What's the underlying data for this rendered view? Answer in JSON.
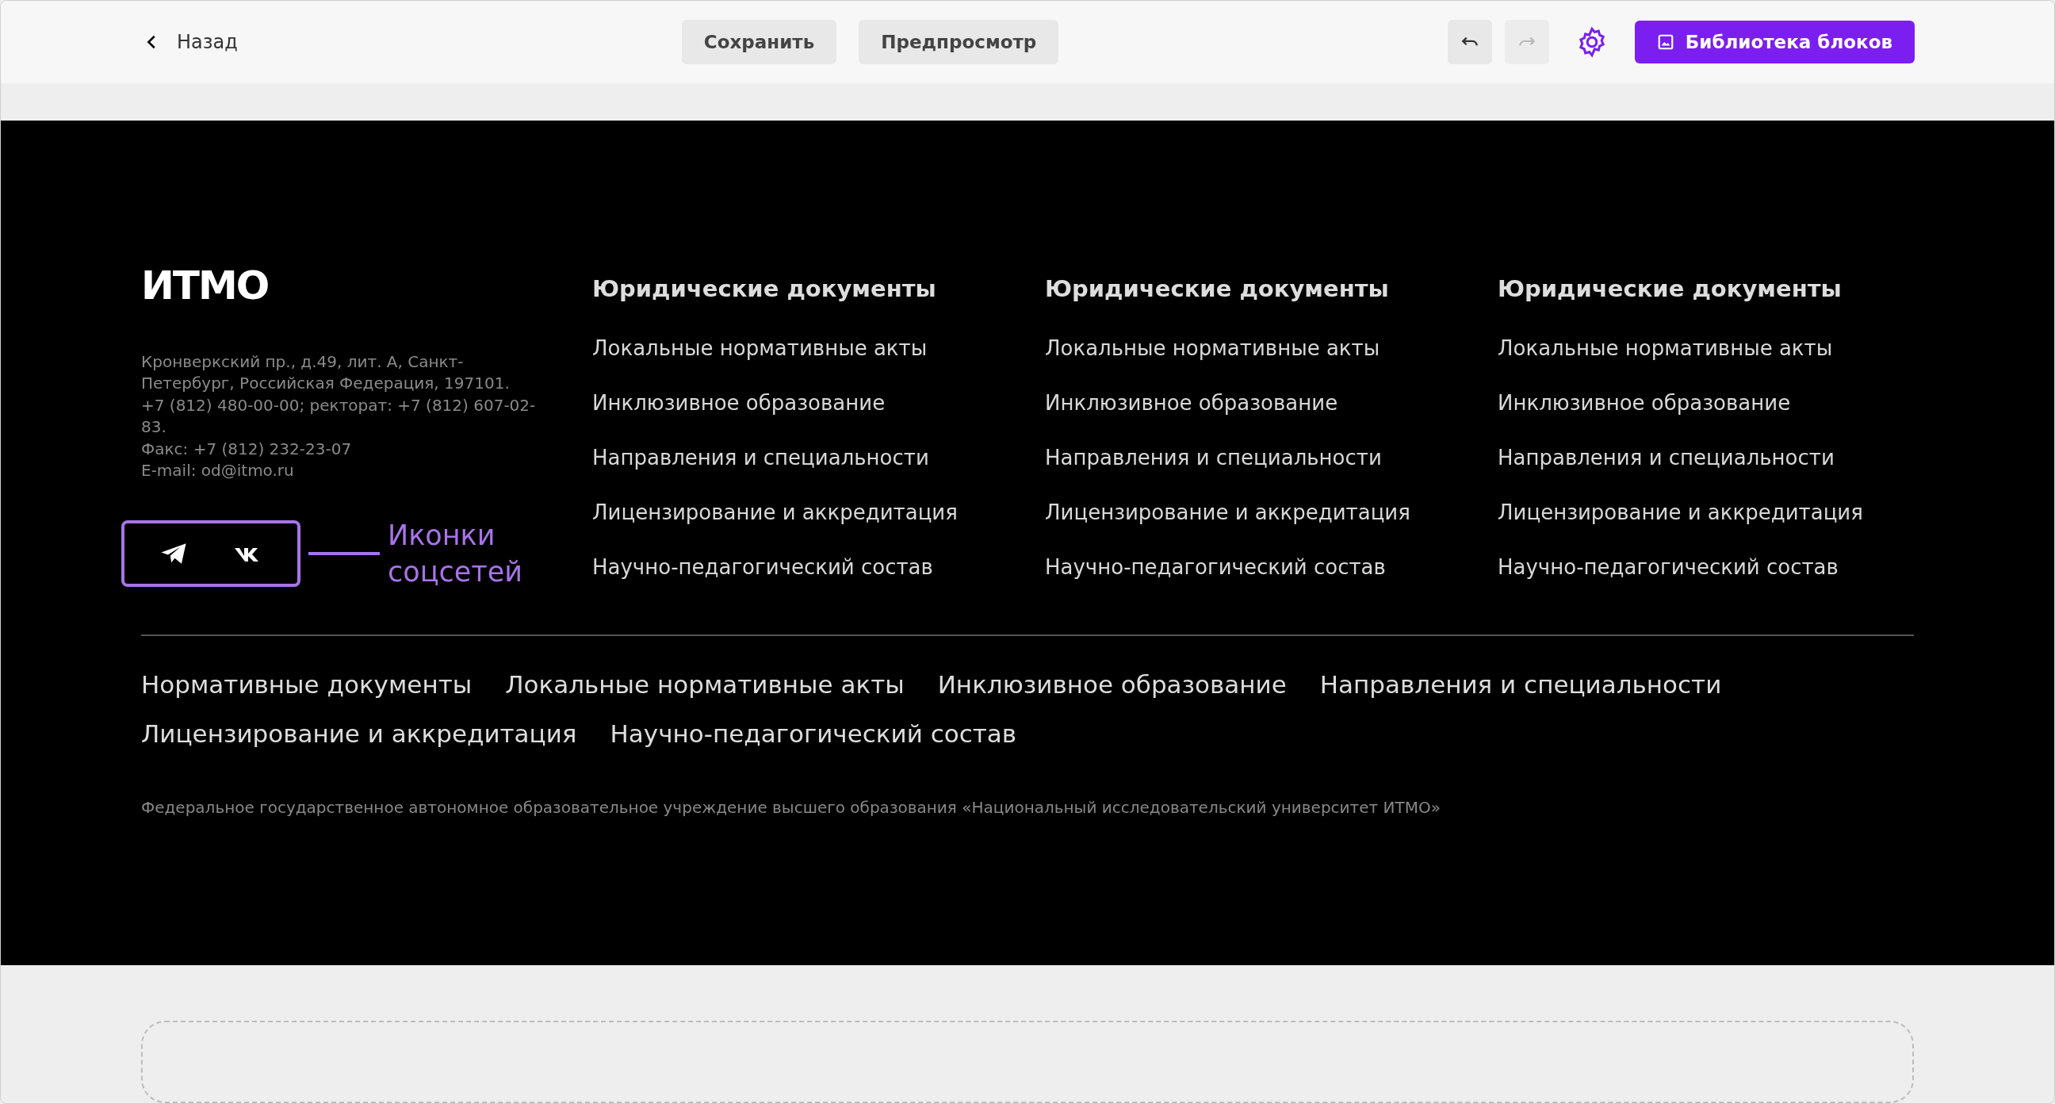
{
  "toolbar": {
    "back": "Назад",
    "save": "Сохранить",
    "preview": "Предпросмотр",
    "library": "Библиотека блоков"
  },
  "footer": {
    "logo": "ИТМО",
    "address": [
      "Кронверкский пр., д.49, лит. А, Санкт-Петербург, Российская Федерация, 197101.",
      "+7 (812) 480-00-00; ректорат: +7 (812) 607-02-83.",
      "Факс: +7 (812) 232-23-07",
      "E-mail: od@itmo.ru"
    ],
    "annotation": "Иконки соцсетей",
    "columns": [
      {
        "title": "Юридические документы",
        "links": [
          "Локальные нормативные акты",
          "Инклюзивное образование",
          "Направления и специальности",
          "Лицензирование и аккредитация",
          "Научно-педагогический состав"
        ]
      },
      {
        "title": "Юридические документы",
        "links": [
          "Локальные нормативные акты",
          "Инклюзивное образование",
          "Направления и специальности",
          "Лицензирование и аккредитация",
          "Научно-педагогический состав"
        ]
      },
      {
        "title": "Юридические документы",
        "links": [
          "Локальные нормативные акты",
          "Инклюзивное образование",
          "Направления и специальности",
          "Лицензирование и аккредитация",
          "Научно-педагогический состав"
        ]
      }
    ],
    "bottom_links": [
      "Нормативные документы",
      "Локальные нормативные акты",
      "Инклюзивное образование",
      "Направления и специальности",
      "Лицензирование и аккредитация",
      "Научно-педагогический состав"
    ],
    "legal": "Федеральное государственное автономное образовательное учреждение высшего образования «Национальный исследовательский университет ИТМО»"
  }
}
